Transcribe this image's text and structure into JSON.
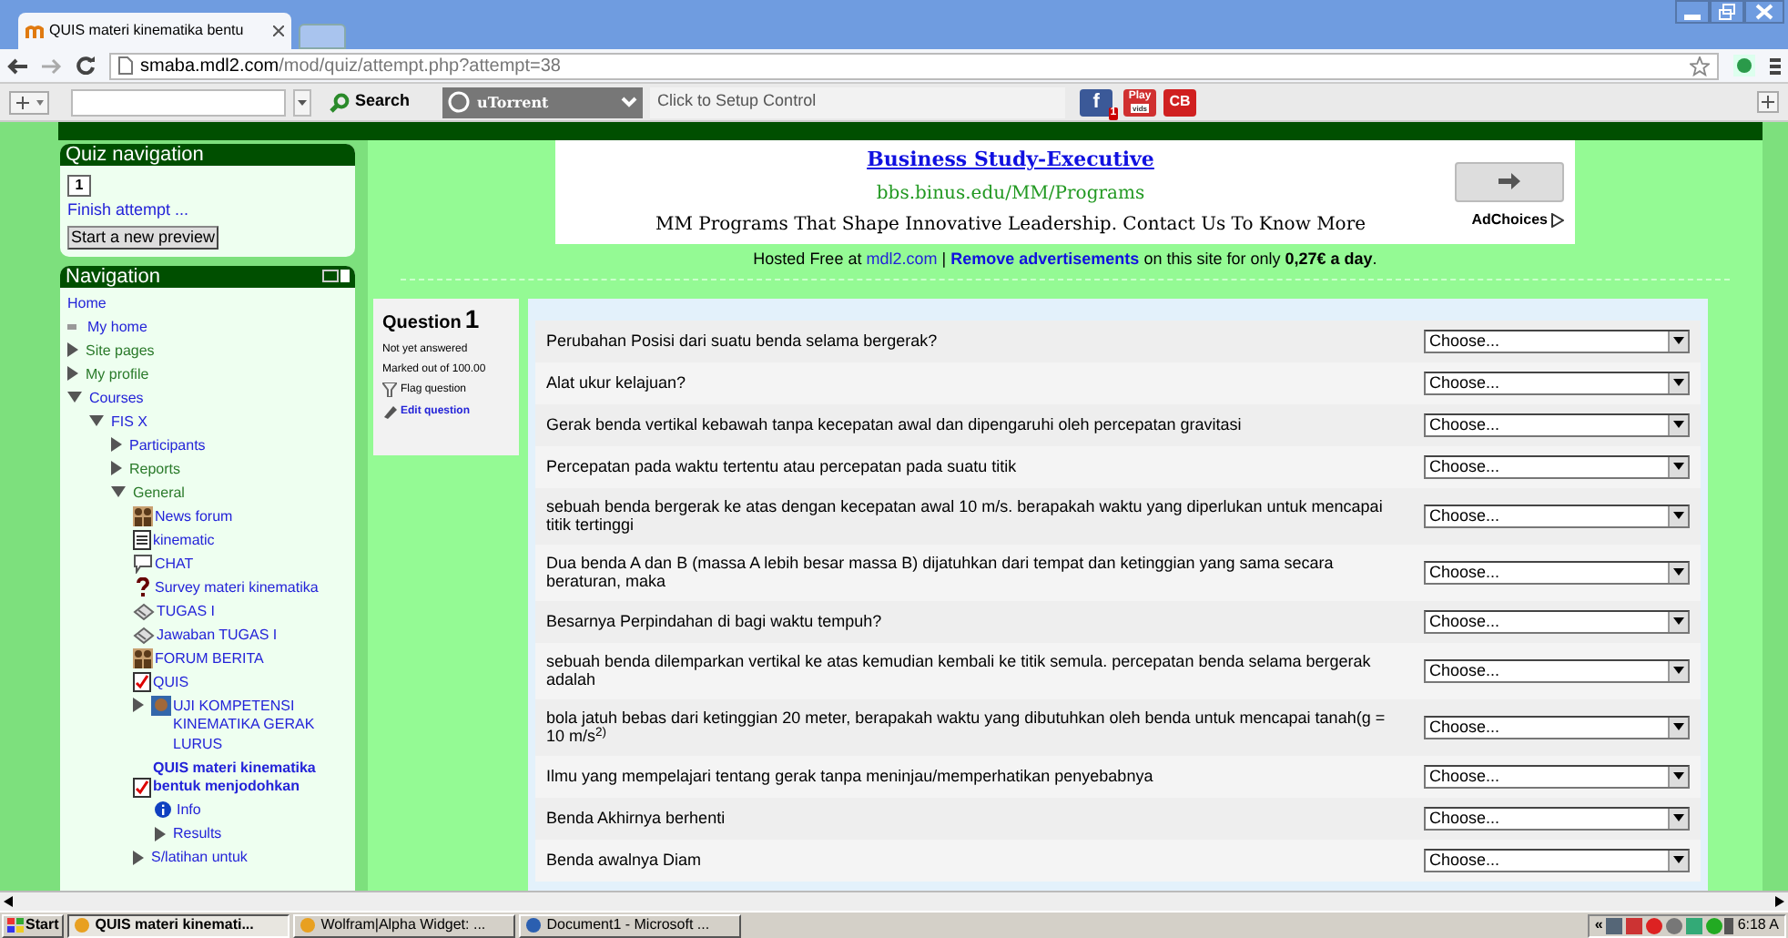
{
  "browser": {
    "tab_title": "QUIS materi kinematika bentu",
    "fb_label": "f",
    "address_host": "smaba.mdl2.com",
    "address_path": "/mod/quiz/attempt.php?attempt=38",
    "search_label": "Search",
    "toolbar_brand": "uTorrent",
    "toolbar_hint": "Click to Setup Control",
    "fb_badge": "1",
    "play_label": "Play",
    "play_sub": "vids",
    "cb_label": "CB"
  },
  "quiz_nav": {
    "title": "Quiz navigation",
    "button": "1",
    "finish": "Finish attempt ...",
    "preview": "Start a new preview"
  },
  "nav": {
    "title": "Navigation",
    "items": [
      {
        "label": "Home",
        "kind": "plain",
        "color": "#2323d8",
        "selected": false
      },
      {
        "label": "My home",
        "kind": "bullet",
        "color": "#2323d8",
        "selected": false
      },
      {
        "label": "Site pages",
        "expanded": false,
        "color": "#2a7a2a",
        "selected": false
      },
      {
        "label": "My profile",
        "expanded": false,
        "color": "#2a7a2a",
        "selected": false
      },
      {
        "label": "Courses",
        "expanded": true,
        "color": "#2323d8",
        "selected": false,
        "children": [
          {
            "label": "FIS X",
            "expanded": true,
            "color": "#2323d8",
            "selected": false,
            "children": [
              {
                "label": "Participants",
                "expanded": false,
                "color": "#2323d8",
                "selected": false
              },
              {
                "label": "Reports",
                "expanded": false,
                "color": "#2a7a2a",
                "selected": false
              },
              {
                "label": "General",
                "expanded": true,
                "color": "#2a7a2a",
                "selected": false,
                "children": [
                  {
                    "label": "News forum",
                    "kind": "forum",
                    "color": "#2323d8",
                    "selected": false
                  },
                  {
                    "label": "kinematic",
                    "kind": "page",
                    "color": "#2323d8",
                    "selected": false
                  },
                  {
                    "label": "CHAT",
                    "kind": "chat",
                    "color": "#2323d8",
                    "selected": false
                  },
                  {
                    "label": "Survey materi kinematika",
                    "kind": "survey",
                    "color": "#2323d8",
                    "selected": false
                  },
                  {
                    "label": "TUGAS I",
                    "kind": "assignment",
                    "color": "#2323d8",
                    "selected": false
                  },
                  {
                    "label": "Jawaban TUGAS I",
                    "kind": "assignment",
                    "color": "#2323d8",
                    "selected": false
                  },
                  {
                    "label": "FORUM BERITA",
                    "kind": "forum",
                    "color": "#2323d8",
                    "selected": false
                  },
                  {
                    "label": "QUIS",
                    "kind": "quiz",
                    "color": "#2323d8",
                    "selected": false
                  },
                  {
                    "label": "UJI KOMPETENSI KINEMATIKA GERAK LURUS",
                    "kind": "lesson",
                    "expanded": false,
                    "color": "#2323d8",
                    "selected": false
                  },
                  {
                    "label": "QUIS materi kinematika bentuk menjodohkan",
                    "kind": "quiz",
                    "color": "#2323d8",
                    "selected": true,
                    "children": [
                      {
                        "label": "Info",
                        "kind": "info",
                        "color": "#2323d8",
                        "selected": false
                      },
                      {
                        "label": "Results",
                        "expanded": false,
                        "color": "#2323d8",
                        "selected": false
                      }
                    ]
                  },
                  {
                    "label": "S/latihan untuk",
                    "expanded": false,
                    "color": "#2323d8",
                    "selected": false
                  }
                ]
              }
            ]
          }
        ]
      }
    ]
  },
  "ad": {
    "title": "Business Study-Executive",
    "url": "bbs.binus.edu/MM/Programs",
    "text": "MM Programs That Shape Innovative Leadership. Contact Us To Know More",
    "choices": "AdChoices"
  },
  "hosted": {
    "prefix": "Hosted Free at",
    "link": "mdl2.com",
    "sep": "|",
    "remove": "Remove advertisements",
    "middle": "on this site for only",
    "price": "0,27€ a day",
    "end": "."
  },
  "question_info": {
    "label": "Question",
    "number": "1",
    "status": "Not yet answered",
    "marks": "Marked out of 100.00",
    "flag": "Flag question",
    "edit": "Edit question"
  },
  "questions": [
    {
      "text": "Perubahan Posisi dari suatu benda selama bergerak?",
      "answer": "Choose..."
    },
    {
      "text": "Alat ukur kelajuan?",
      "answer": "Choose..."
    },
    {
      "text": "Gerak benda vertikal kebawah tanpa kecepatan awal dan dipengaruhi oleh percepatan gravitasi",
      "answer": "Choose..."
    },
    {
      "text": "Percepatan pada waktu tertentu atau percepatan pada suatu titik",
      "answer": "Choose..."
    },
    {
      "text": "sebuah benda bergerak ke atas dengan kecepatan awal 10 m/s. berapakah waktu yang diperlukan untuk mencapai titik tertinggi",
      "answer": "Choose..."
    },
    {
      "text": "Dua benda A dan B (massa A lebih besar massa B) dijatuhkan dari tempat dan ketinggian yang sama secara beraturan, maka",
      "answer": "Choose..."
    },
    {
      "text": "Besarnya Perpindahan di bagi waktu tempuh?",
      "answer": "Choose..."
    },
    {
      "text": "sebuah benda dilemparkan vertikal ke atas kemudian kembali ke titik semula. percepatan benda selama bergerak adalah",
      "answer": "Choose..."
    },
    {
      "text": "bola jatuh bebas dari ketinggian 20  meter, berapakah waktu yang dibutuhkan oleh benda untuk mencapai tanah(g = 10 m/s$^{2)}$",
      "answer": "Choose..."
    },
    {
      "text": "Ilmu yang mempelajari tentang gerak tanpa meninjau/memperhatikan penyebabnya",
      "answer": "Choose..."
    },
    {
      "text": "Benda Akhirnya berhenti",
      "answer": "Choose..."
    },
    {
      "text": "Benda awalnya Diam",
      "answer": "Choose..."
    }
  ],
  "taskbar": {
    "start": "Start",
    "tasks": [
      {
        "label": "QUIS materi kinemati...",
        "selected": true
      },
      {
        "label": "Wolfram|Alpha Widget: ...",
        "selected": false
      },
      {
        "label": "Document1 - Microsoft ...",
        "selected": false
      }
    ],
    "tray_expand": "«",
    "time": "6:18 A"
  }
}
